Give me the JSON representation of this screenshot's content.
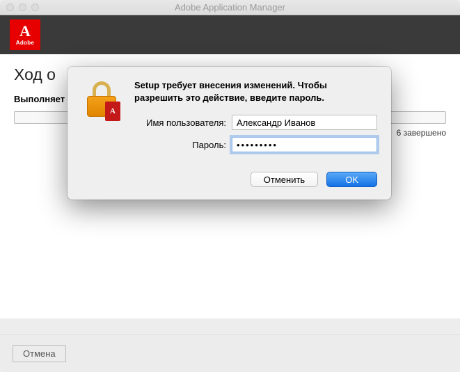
{
  "window": {
    "title": "Adobe Application Manager"
  },
  "logo": {
    "brand": "Adobe"
  },
  "page": {
    "title": "Ход о",
    "subtitle": "Выполняет",
    "status": "6 завершено"
  },
  "footer": {
    "cancel": "Отмена"
  },
  "dialog": {
    "message": "Setup требует внесения изменений. Чтобы разрешить это действие, введите пароль.",
    "username_label": "Имя пользователя:",
    "username_value": "Александр Иванов",
    "password_label": "Пароль:",
    "password_mask": "•••••••••",
    "cancel": "Отменить",
    "ok": "OK",
    "lock_overlay_glyph": "A"
  }
}
